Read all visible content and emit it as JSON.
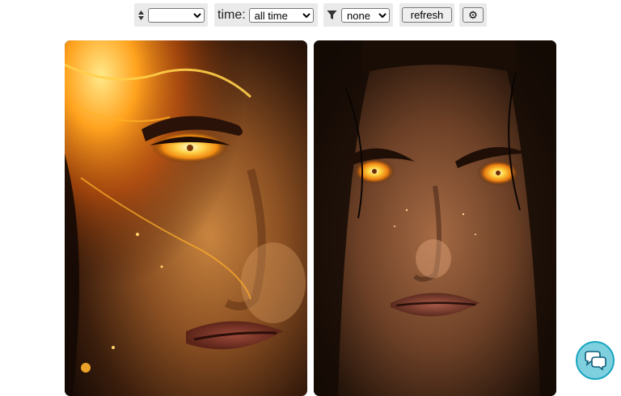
{
  "toolbar": {
    "sort": {
      "icon": "sort-updown-icon",
      "selected": ""
    },
    "time": {
      "label": "time:",
      "selected": "all time"
    },
    "filter": {
      "icon": "filter-funnel-icon",
      "selected": "none"
    },
    "refresh_label": "refresh",
    "settings_icon": "⚙"
  },
  "gallery": {
    "images": [
      {
        "name": "fiery-eye-portrait-left"
      },
      {
        "name": "glowing-eyes-portrait-right"
      }
    ]
  },
  "chat": {
    "icon": "chat-bubbles-icon"
  }
}
